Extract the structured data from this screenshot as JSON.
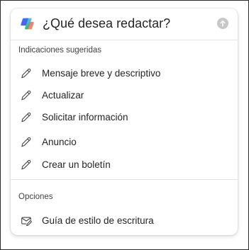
{
  "header": {
    "prompt": "¿Qué desea redactar?",
    "logo_icon": "copilot-logo-icon",
    "send_icon": "send-arrow-up-icon"
  },
  "suggested": {
    "label": "Indicaciones sugeridas",
    "items": [
      {
        "label": "Mensaje breve y descriptivo",
        "icon": "pencil-icon"
      },
      {
        "label": "Actualizar",
        "icon": "pencil-icon"
      },
      {
        "label": "Solicitar información",
        "icon": "pencil-icon"
      },
      {
        "label": "Anuncio",
        "icon": "pencil-icon"
      },
      {
        "label": "Crear un boletín",
        "icon": "pencil-icon"
      }
    ]
  },
  "options": {
    "label": "Opciones",
    "items": [
      {
        "label": "Guía de estilo de escritura",
        "icon": "mail-edit-icon"
      }
    ]
  },
  "colors": {
    "text": "#242424",
    "muted": "#424242",
    "divider": "#e6e6e6",
    "send_disabled": "#c8c8c8"
  }
}
